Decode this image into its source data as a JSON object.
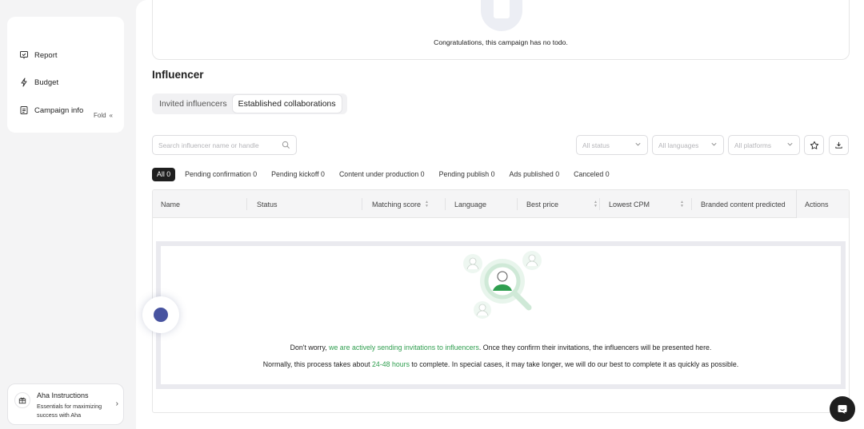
{
  "sidebar": {
    "items": [
      {
        "label": "Report",
        "icon": "report-icon"
      },
      {
        "label": "Budget",
        "icon": "bolt-icon"
      },
      {
        "label": "Campaign info",
        "icon": "document-icon"
      }
    ],
    "fold_label": "Fold",
    "fold_icon": "double-chevron-left-icon"
  },
  "aha": {
    "title": "Aha Instructions",
    "subtitle": "Essentials for maximizing success with Aha"
  },
  "todo": {
    "message": "Congratulations, this campaign has no todo."
  },
  "influencer": {
    "title": "Influencer",
    "tabs": [
      {
        "label": "Invited influencers",
        "active": false
      },
      {
        "label": "Established collaborations",
        "active": true
      }
    ],
    "search_placeholder": "Search influencer name or handle",
    "selects": {
      "status": "All status",
      "languages": "All languages",
      "platforms": "All platforms"
    },
    "filters": [
      {
        "label": "All 0",
        "active": true
      },
      {
        "label": "Pending confirmation 0",
        "active": false
      },
      {
        "label": "Pending kickoff 0",
        "active": false
      },
      {
        "label": "Content under production 0",
        "active": false
      },
      {
        "label": "Pending publish 0",
        "active": false
      },
      {
        "label": "Ads published 0",
        "active": false
      },
      {
        "label": "Canceled 0",
        "active": false
      }
    ],
    "columns": [
      "Name",
      "Status",
      "Matching score",
      "Language",
      "Best price",
      "Lowest CPM",
      "Branded content predicted",
      "Actions"
    ],
    "empty": {
      "line1_prefix": "Don't worry, ",
      "line1_highlight": "we are actively sending invitations to influencers",
      "line1_suffix": ". Once they confirm their invitations, the influencers will be presented here.",
      "line2_prefix": "Normally, this process takes about ",
      "line2_highlight": "24-48 hours",
      "line2_suffix": " to complete. In special cases, it may take longer, we will do our best to complete it as quickly as possible."
    }
  },
  "colors": {
    "accent_green": "#2f9e4f",
    "active_chip": "#1f1f1f",
    "fab_blue": "#4753a0"
  }
}
